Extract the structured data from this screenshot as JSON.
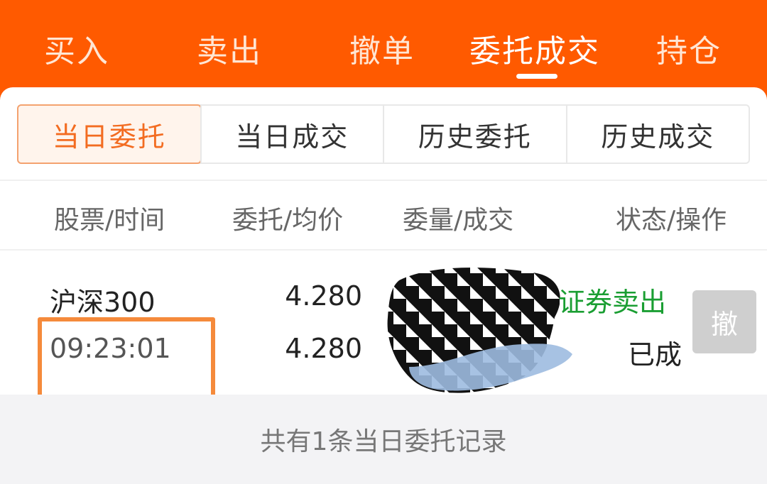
{
  "top_tabs": [
    {
      "label": "买入"
    },
    {
      "label": "卖出"
    },
    {
      "label": "撤单"
    },
    {
      "label": "委托成交"
    },
    {
      "label": "持仓"
    }
  ],
  "active_top_tab": "委托成交",
  "sub_tabs": [
    {
      "label": "当日委托"
    },
    {
      "label": "当日成交"
    },
    {
      "label": "历史委托"
    },
    {
      "label": "历史成交"
    }
  ],
  "active_sub_tab": "当日委托",
  "columns": {
    "stock_time": "股票/时间",
    "price": "委托/均价",
    "qty": "委量/成交",
    "status": "状态/操作"
  },
  "order": {
    "stock": "沪深300",
    "time": "09:23:01",
    "order_price": "4.280",
    "avg_price": "4.280",
    "direction": "证券卖出",
    "status": "已成",
    "cancel_label": "撤"
  },
  "footer_text": "共有1条当日委托记录",
  "colors": {
    "brand": "#ff5a00",
    "active_sub_tab": "#f36c21",
    "direction_text": "#1a9e32"
  }
}
